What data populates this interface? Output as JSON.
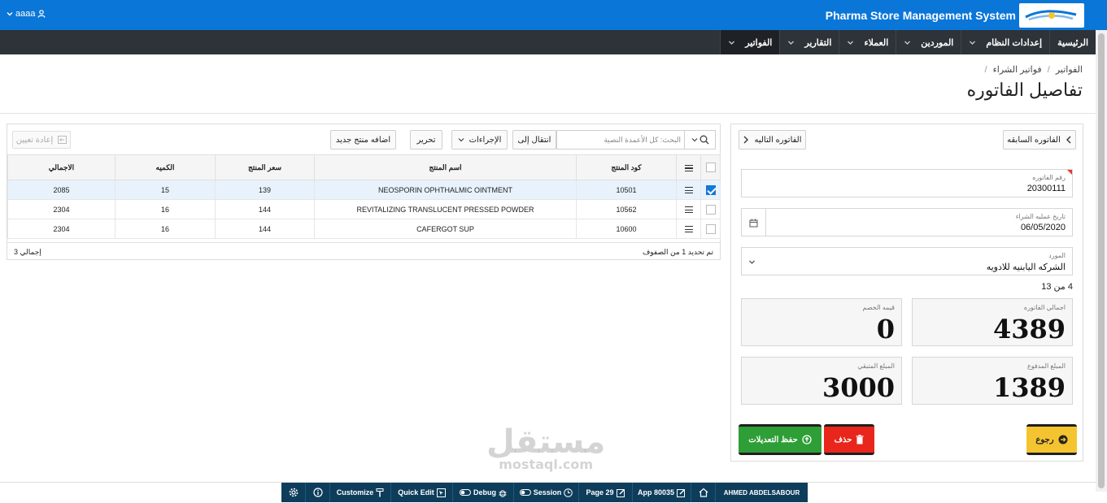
{
  "header": {
    "app_title": "Pharma Store Management System",
    "user_name": "aaaa"
  },
  "nav": [
    {
      "label": "الرئيسية",
      "has_menu": false
    },
    {
      "label": "إعدادات النظام",
      "has_menu": true
    },
    {
      "label": "الموردين",
      "has_menu": true
    },
    {
      "label": "العملاء",
      "has_menu": true
    },
    {
      "label": "التقارير",
      "has_menu": true
    },
    {
      "label": "الفواتير",
      "has_menu": true,
      "active": true
    }
  ],
  "breadcrumb": {
    "items": [
      "الفواتير",
      "فواتير الشراء"
    ],
    "separator": "/"
  },
  "page_title": "تفاصيل الفاتوره",
  "invoice": {
    "prev_label": "الفاتوره السابقه",
    "next_label": "الفاتوره التاليه",
    "number_label": "رقم الفاتوره",
    "number_value": "20300111",
    "date_label": "تاريخ عمليه الشراء",
    "date_value": "06/05/2020",
    "supplier_label": "المورد",
    "supplier_value": "الشركه اليابنيه للادويه",
    "record_count": "4 من 13",
    "total_label": "اجمالي الفاتوره",
    "total_value": "4389",
    "discount_label": "قيمه الخصم",
    "discount_value": "0",
    "paid_label": "المبلغ المدفوع",
    "paid_value": "1389",
    "remaining_label": "المبلغ المتبقي",
    "remaining_value": "3000",
    "back_label": "رجوع",
    "delete_label": "حذف",
    "save_label": "حفظ التعديلات"
  },
  "grid": {
    "search_placeholder": "البحث: كل الأعمدة النصية",
    "goto_label": "انتقال إلى",
    "actions_label": "الإجراءات",
    "edit_label": "تحرير",
    "add_label": "اضافه منتج جديد",
    "reset_label": "إعادة تعيين",
    "columns": [
      "كود المنتج",
      "اسم المنتج",
      "سعر المنتج",
      "الكميه",
      "الاجمالي"
    ],
    "rows": [
      {
        "code": "10501",
        "name": "NEOSPORIN OPHTHALMIC OINTMENT",
        "price": "139",
        "qty": "15",
        "total": "2085",
        "selected": true
      },
      {
        "code": "10562",
        "name": "REVITALIZING TRANSLUCENT PRESSED POWDER",
        "price": "144",
        "qty": "16",
        "total": "2304",
        "selected": false
      },
      {
        "code": "10600",
        "name": "CAFERGOT SUP",
        "price": "144",
        "qty": "16",
        "total": "2304",
        "selected": false
      }
    ],
    "selection_status": "تم تحديد 1 من الصفوف",
    "total_count": "إجمالي 3"
  },
  "dev_toolbar": {
    "user": "AHMED ABDELSABOUR",
    "app": "App 80035",
    "page": "Page 29",
    "session": "Session",
    "debug": "Debug",
    "quick_edit": "Quick Edit",
    "customize": "Customize"
  },
  "watermark": {
    "text": "مستقل",
    "sub": "mostaql.com"
  },
  "colors": {
    "topbar": "#0a76d8",
    "navbar": "#2d3338",
    "save": "#2e9e36",
    "delete": "#e8261c",
    "back": "#f4c430",
    "devbar": "#0e3d5c"
  }
}
